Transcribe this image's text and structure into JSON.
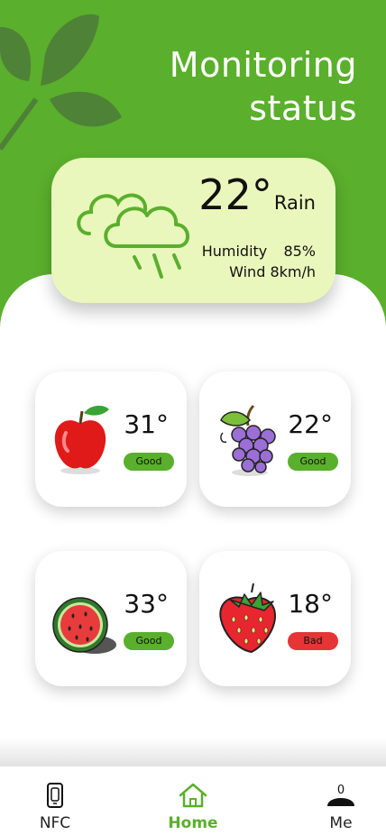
{
  "header": {
    "title_line1": "Monitoring",
    "title_line2": "status"
  },
  "weather": {
    "icon": "cloud-rain-icon",
    "temperature": "22°",
    "condition": "Rain",
    "humidity": "Humidity  85%",
    "wind": "Wind 8km/h"
  },
  "fruits": [
    {
      "name": "apple",
      "icon": "apple-icon",
      "temperature": "31°",
      "status": "Good"
    },
    {
      "name": "grapes",
      "icon": "grapes-icon",
      "temperature": "22°",
      "status": "Good"
    },
    {
      "name": "watermelon",
      "icon": "watermelon-icon",
      "temperature": "33°",
      "status": "Good"
    },
    {
      "name": "strawberry",
      "icon": "strawberry-icon",
      "temperature": "18°",
      "status": "Bad"
    }
  ],
  "nav": {
    "items": [
      {
        "label": "NFC",
        "icon": "nfc-phone-icon"
      },
      {
        "label": "Home",
        "icon": "home-icon",
        "active": true
      },
      {
        "label": "Me",
        "icon": "user-icon",
        "badge": "0"
      }
    ]
  },
  "colors": {
    "brand": "#5aaf2c",
    "weather_card": "#e9f7bc",
    "good": "#5aaf2c",
    "bad": "#e53535"
  }
}
